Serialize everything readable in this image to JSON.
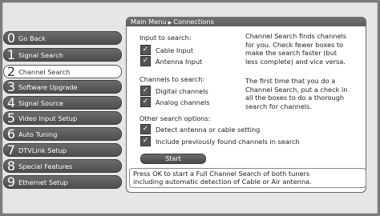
{
  "header": {
    "part1": "Main Menu",
    "part2": "Connections"
  },
  "menu": [
    {
      "num": "0",
      "label": "Go Back",
      "state": "dark"
    },
    {
      "num": "1",
      "label": "Signal Search",
      "state": "dark"
    },
    {
      "num": "2",
      "label": "Channel Search",
      "state": "selected"
    },
    {
      "num": "3",
      "label": "Software Upgrade",
      "state": "dark"
    },
    {
      "num": "4",
      "label": "Signal Source",
      "state": "dark"
    },
    {
      "num": "5",
      "label": "Video Input Setup",
      "state": "dark"
    },
    {
      "num": "6",
      "label": "Auto Tuning",
      "state": "dark"
    },
    {
      "num": "7",
      "label": "DTVLink Setup",
      "state": "dark"
    },
    {
      "num": "8",
      "label": "Special Features",
      "state": "dark"
    },
    {
      "num": "9",
      "label": "Ethernet Setup",
      "state": "dark"
    }
  ],
  "input": {
    "title": "Input to search:",
    "options": [
      {
        "label": "Cable Input",
        "checked": true
      },
      {
        "label": "Antenna Input",
        "checked": true
      }
    ]
  },
  "channels": {
    "title": "Channels to search:",
    "options": [
      {
        "label": "Digital channels",
        "checked": true
      },
      {
        "label": "Analog channels",
        "checked": true
      }
    ]
  },
  "other": {
    "title": "Other search options:",
    "options": [
      {
        "label": "Detect antenna or cable setting",
        "checked": true
      },
      {
        "label": "Include previously found channels in search",
        "checked": true
      }
    ]
  },
  "desc1": [
    "Channel Search finds channels",
    "for you. Check fewer boxes to",
    "make the search faster (but",
    "less complete) and vice versa."
  ],
  "desc2": [
    "The first time that you do a",
    "Channel Search, put a check in",
    "all the boxes to do a thorough",
    "search for channels."
  ],
  "start_label": "Start",
  "status": [
    "Press OK to start a Full Channel Search of both tuners",
    "including automatic detection of Cable or Air antenna."
  ]
}
